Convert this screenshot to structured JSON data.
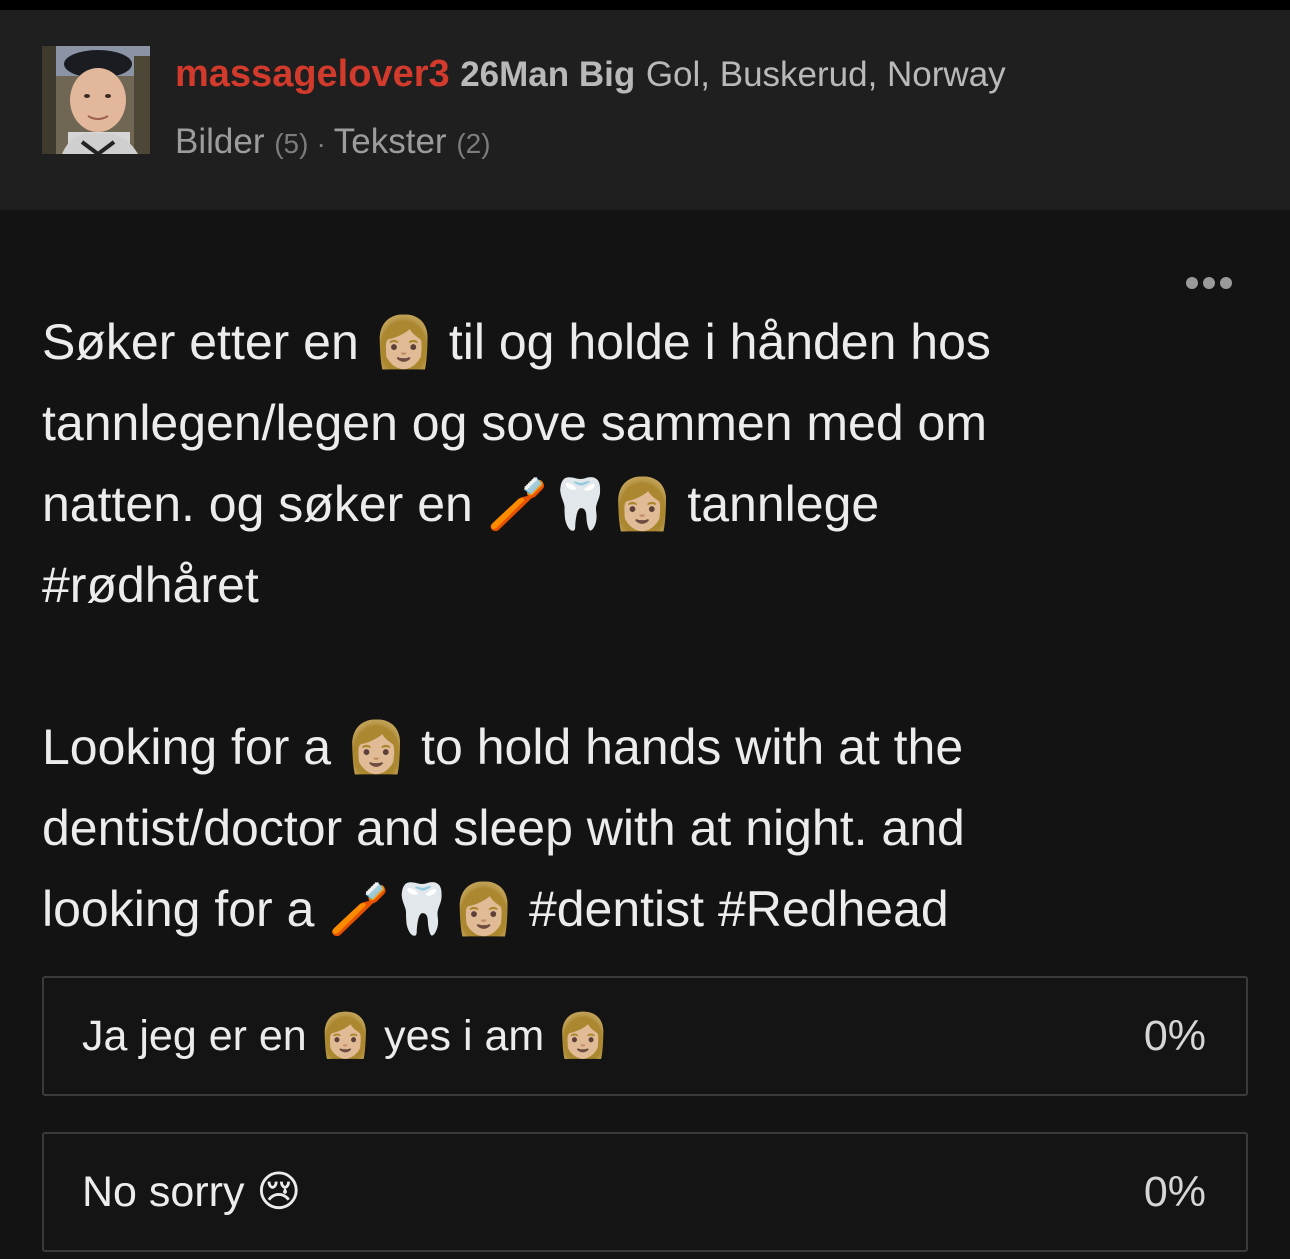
{
  "profile": {
    "username": "massagelover3",
    "age_gender": "26Man Big",
    "location": "Gol, Buskerud, Norway",
    "tabs": [
      {
        "label": "Bilder",
        "count": "(5)"
      },
      {
        "label": "Tekster",
        "count": "(2)"
      }
    ],
    "separator": "·",
    "avatar_icon": "profile-photo"
  },
  "post": {
    "more_icon": "ellipsis-icon",
    "text": "Søker etter en 👩🏼 til og holde i hånden hos\ntannlegen/legen og sove sammen med om\nnatten. og søker en 🪥🦷👩🏼 tannlege\n#rødhåret\n\nLooking for a 👩🏼 to hold hands with at the\ndentist/doctor and sleep with at night. and\nlooking for a 🪥🦷👩🏼 #dentist #Redhead"
  },
  "poll": {
    "options": [
      {
        "label": "Ja jeg er en 👩🏼 yes i am 👩🏼",
        "percent": "0%"
      },
      {
        "label": "No sorry 😢",
        "percent": "0%"
      }
    ]
  },
  "colors": {
    "username": "#d23a2c",
    "background": "#131313",
    "header": "#1f1f1f"
  }
}
